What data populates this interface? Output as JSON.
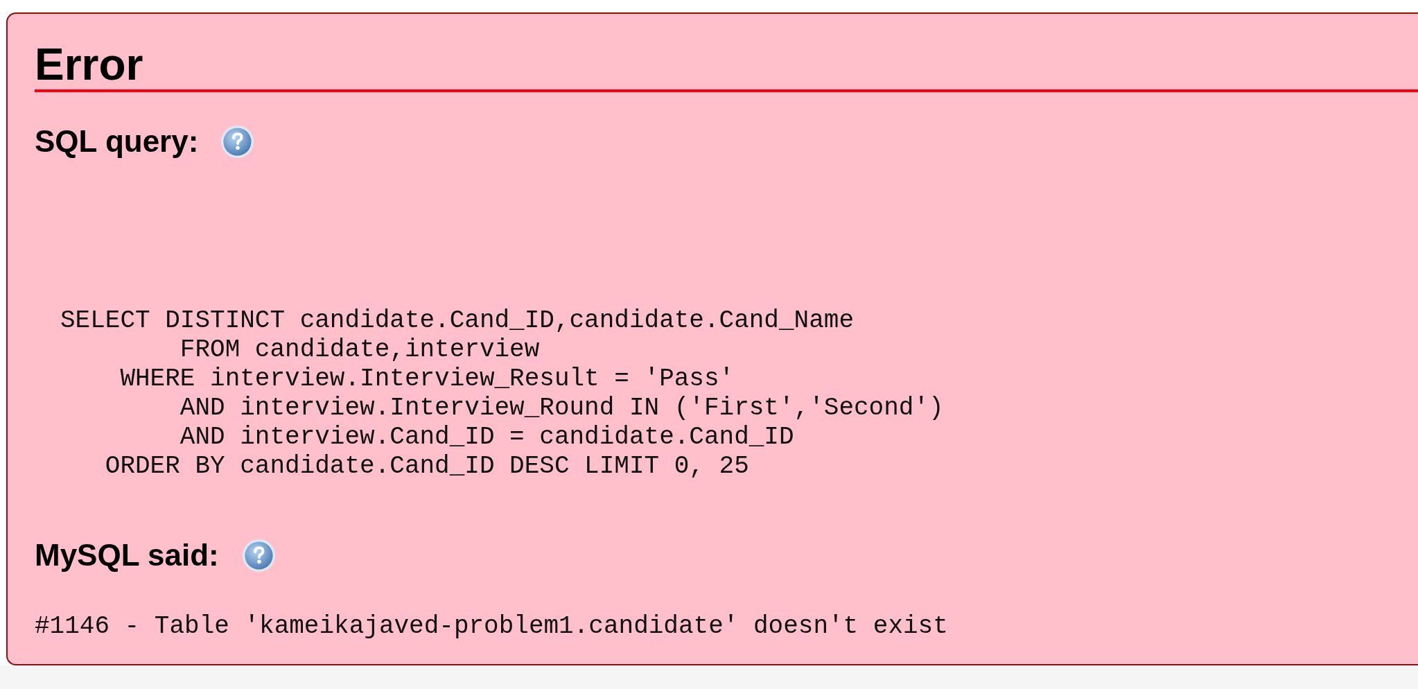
{
  "error_box": {
    "title": "Error",
    "sql_query": {
      "label": "SQL query:",
      "query": "SELECT DISTINCT candidate.Cand_ID,candidate.Cand_Name\n        FROM candidate,interview\n    WHERE interview.Interview_Result = 'Pass'\n        AND interview.Interview_Round IN ('First','Second')\n        AND interview.Cand_ID = candidate.Cand_ID\n   ORDER BY candidate.Cand_ID DESC LIMIT 0, 25"
    },
    "mysql_said": {
      "label": "MySQL said:",
      "message": "#1146 - Table 'kameikajaved-problem1.candidate' doesn't exist"
    }
  }
}
